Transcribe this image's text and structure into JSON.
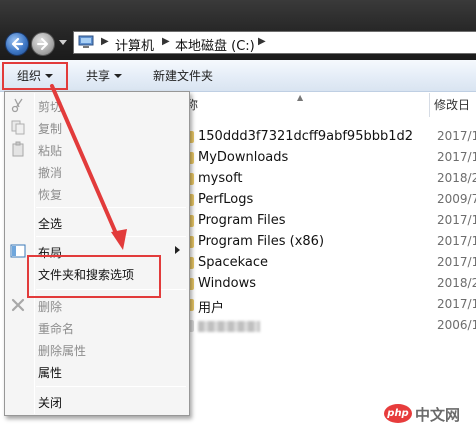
{
  "address": {
    "breadcrumbs": [
      "计算机",
      "本地磁盘 (C:)"
    ]
  },
  "toolbar": {
    "organize": "组织",
    "share": "共享",
    "new_folder": "新建文件夹"
  },
  "columns": {
    "name": "称",
    "date": "修改日"
  },
  "files": [
    {
      "name": "150ddd3f7321dcff9abf95bbb1d2",
      "date": "2017/1"
    },
    {
      "name": "MyDownloads",
      "date": "2017/1"
    },
    {
      "name": "mysoft",
      "date": "2018/2"
    },
    {
      "name": "PerfLogs",
      "date": "2009/7"
    },
    {
      "name": "Program Files",
      "date": "2017/1"
    },
    {
      "name": "Program Files (x86)",
      "date": "2017/1"
    },
    {
      "name": "Spacekace",
      "date": "2017/1"
    },
    {
      "name": "Windows",
      "date": "2018/2"
    },
    {
      "name": "用户",
      "date": "2017/1"
    },
    {
      "name": "",
      "date": "2006/1"
    }
  ],
  "menu": {
    "cut": "剪切",
    "copy": "复制",
    "paste": "粘贴",
    "undo": "撤消",
    "redo": "恢复",
    "select_all": "全选",
    "layout": "布局",
    "folder_options": "文件夹和搜索选项",
    "delete": "删除",
    "rename": "重命名",
    "remove_props": "删除属性",
    "properties": "属性",
    "close": "关闭"
  },
  "watermark": {
    "logo": "php",
    "text": "中文网"
  },
  "colors": {
    "annotation": "#e23b3b",
    "address_bar": "#262626",
    "toolbar": "#e6eef8",
    "menu_bg": "#f5f5f5"
  }
}
